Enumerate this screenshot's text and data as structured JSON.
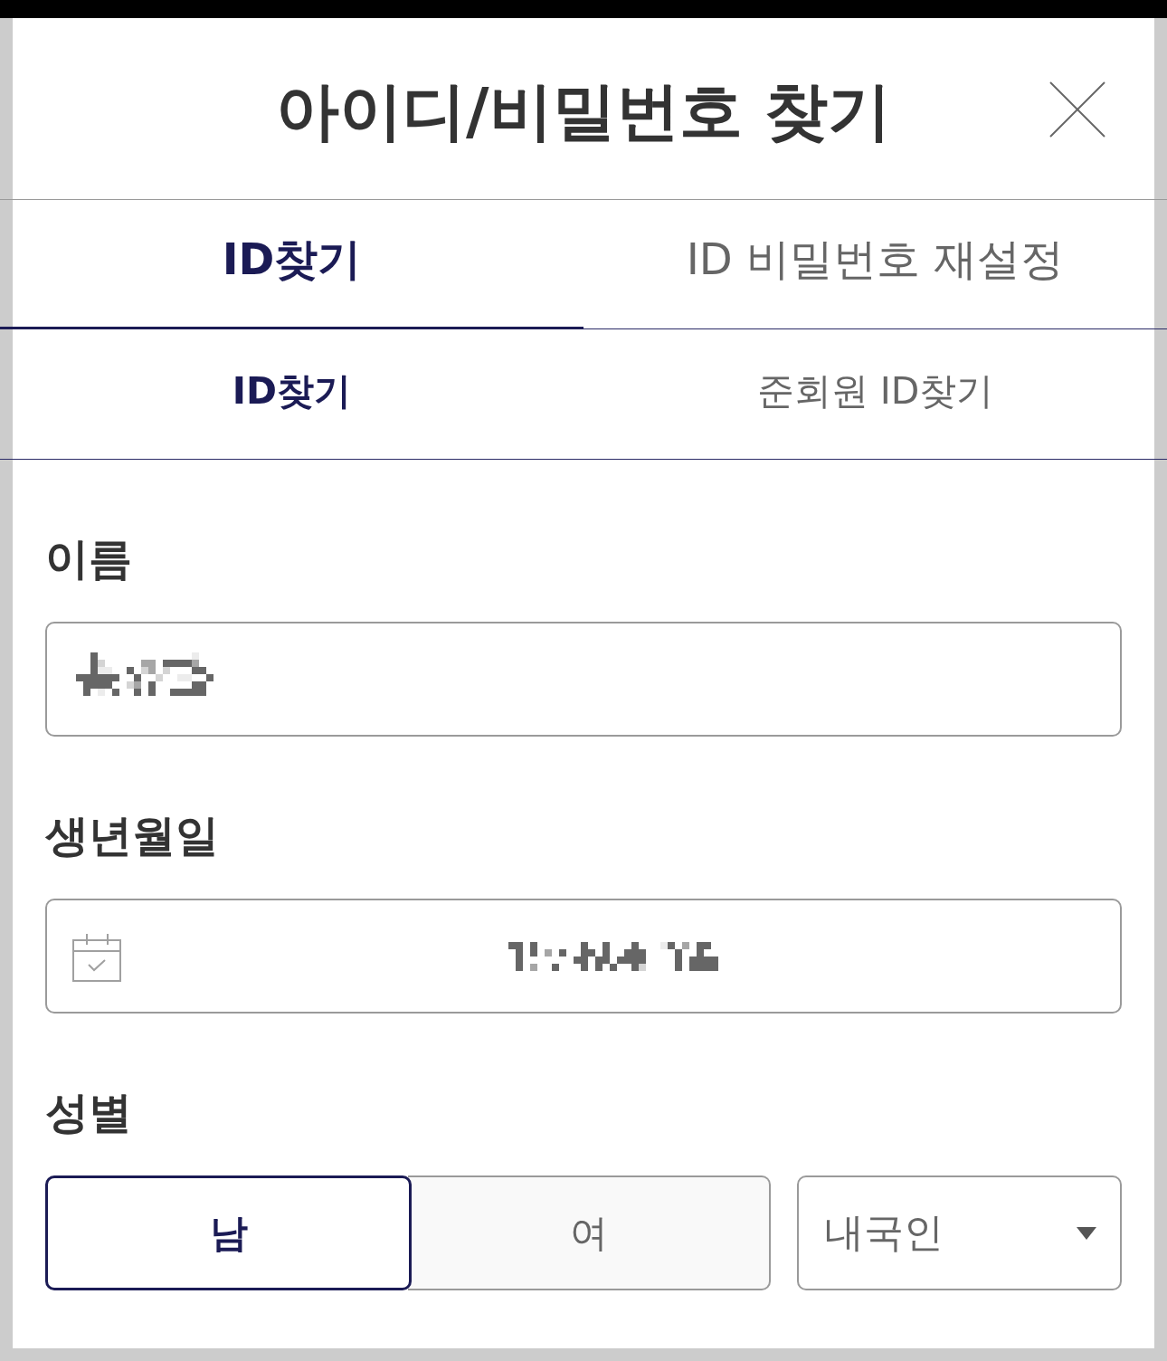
{
  "dialog": {
    "title": "아이디/비밀번호 찾기"
  },
  "tabs": [
    {
      "label": "ID찾기",
      "selected": true
    },
    {
      "label": "ID 비밀번호 재설정",
      "selected": false
    }
  ],
  "subtabs": [
    {
      "label": "ID찾기",
      "selected": true
    },
    {
      "label": "준회원 ID찾기",
      "selected": false
    }
  ],
  "fields": [
    {
      "kind": "text",
      "label": "이름",
      "redacted": true
    },
    {
      "kind": "date",
      "label": "생년월일",
      "redacted": true
    }
  ],
  "gender": {
    "label": "성별",
    "options": [
      {
        "label": "남",
        "selected": true
      },
      {
        "label": "여",
        "selected": false
      }
    ]
  },
  "nationality": {
    "value": "내국인"
  }
}
